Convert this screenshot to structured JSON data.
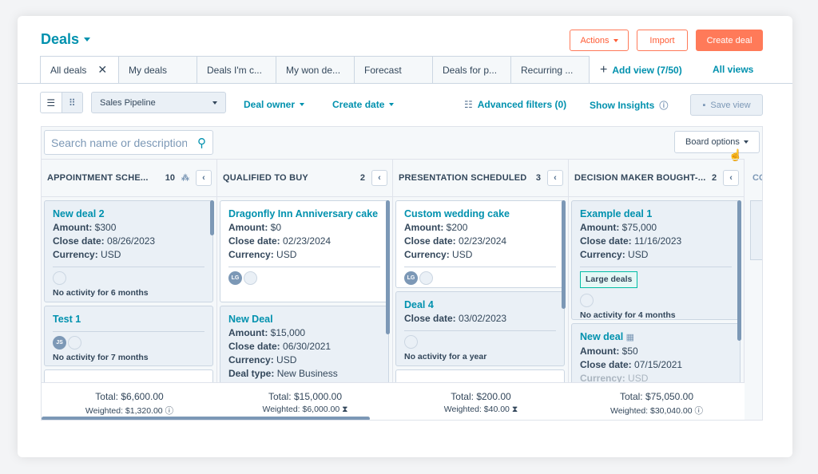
{
  "header": {
    "title": "Deals",
    "actions_label": "Actions",
    "import_label": "Import",
    "create_label": "Create deal"
  },
  "tabs": [
    {
      "label": "All deals",
      "closable": true
    },
    {
      "label": "My deals"
    },
    {
      "label": "Deals I'm c..."
    },
    {
      "label": "My won de..."
    },
    {
      "label": "Forecast"
    },
    {
      "label": "Deals for p..."
    },
    {
      "label": "Recurring ..."
    }
  ],
  "add_view_label": "Add view (7/50)",
  "all_views_label": "All views",
  "toolbar": {
    "pipeline": "Sales Pipeline",
    "deal_owner": "Deal owner",
    "create_date": "Create date",
    "advanced_filters": "Advanced filters (0)",
    "show_insights": "Show Insights",
    "save_view": "Save view"
  },
  "search": {
    "placeholder": "Search name or description"
  },
  "board_options_label": "Board options",
  "columns": [
    {
      "name": "APPOINTMENT SCHE...",
      "count": "10",
      "total": "Total: $6,600.00",
      "weighted": "Weighted: $1,320.00",
      "cards": [
        {
          "name": "New deal 2",
          "amount": "$300",
          "close_date": "08/26/2023",
          "currency": "USD",
          "activity": "No activity for 6 months"
        },
        {
          "name": "Test 1",
          "avatar": "JS",
          "activity": "No activity for 7 months"
        }
      ]
    },
    {
      "name": "QUALIFIED TO BUY",
      "count": "2",
      "total": "Total: $15,000.00",
      "weighted": "Weighted: $6,000.00",
      "cards": [
        {
          "name": "Dragonfly Inn Anniversary cake",
          "amount": "$0",
          "close_date": "02/23/2024",
          "currency": "USD",
          "avatar": "LG"
        },
        {
          "name": "New Deal",
          "amount": "$15,000",
          "close_date": "06/30/2021",
          "currency": "USD",
          "deal_type": "New Business"
        }
      ]
    },
    {
      "name": "PRESENTATION SCHEDULED",
      "count": "3",
      "total": "Total: $200.00",
      "weighted": "Weighted: $40.00",
      "cards": [
        {
          "name": "Custom wedding cake",
          "amount": "$200",
          "close_date": "02/23/2024",
          "currency": "USD",
          "avatar": "LG"
        },
        {
          "name": "Deal 4",
          "close_date": "03/02/2023",
          "activity": "No activity for a year"
        }
      ]
    },
    {
      "name": "DECISION MAKER BOUGHT-...",
      "count": "2",
      "total": "Total: $75,050.00",
      "weighted": "Weighted: $30,040.00",
      "cards": [
        {
          "name": "Example deal 1",
          "amount": "$75,000",
          "close_date": "11/16/2023",
          "currency": "USD",
          "tag": "Large deals",
          "activity": "No activity for 4 months"
        },
        {
          "name": "New deal",
          "amount": "$50",
          "close_date": "07/15/2021",
          "currency": "USD"
        }
      ]
    }
  ],
  "partial_column_label": "CO",
  "field_labels": {
    "amount": "Amount:",
    "close_date": "Close date:",
    "currency": "Currency:",
    "deal_type": "Deal type:"
  },
  "colors": {
    "accent": "#0091ae",
    "orange": "#ff7a59"
  }
}
